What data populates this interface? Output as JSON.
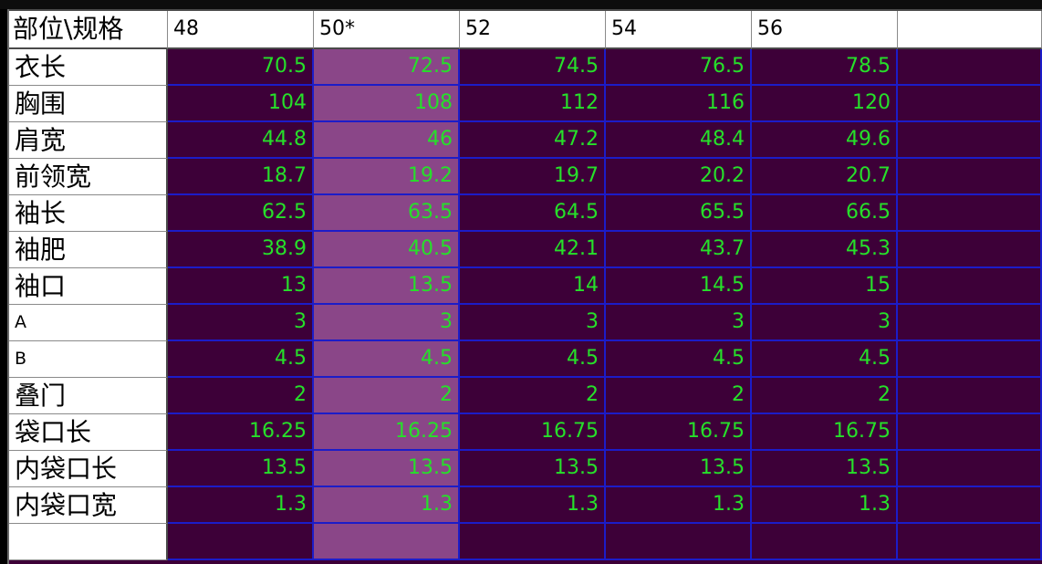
{
  "table": {
    "corner_label": "部位\\规格",
    "size_columns": [
      "48",
      "50*",
      "52",
      "54",
      "56"
    ],
    "selected_column": 1,
    "rows": [
      {
        "label": "衣长",
        "values": [
          "70.5",
          "72.5",
          "74.5",
          "76.5",
          "78.5"
        ]
      },
      {
        "label": "胸围",
        "values": [
          "104",
          "108",
          "112",
          "116",
          "120"
        ]
      },
      {
        "label": "肩宽",
        "values": [
          "44.8",
          "46",
          "47.2",
          "48.4",
          "49.6"
        ]
      },
      {
        "label": "前领宽",
        "values": [
          "18.7",
          "19.2",
          "19.7",
          "20.2",
          "20.7"
        ]
      },
      {
        "label": "袖长",
        "values": [
          "62.5",
          "63.5",
          "64.5",
          "65.5",
          "66.5"
        ]
      },
      {
        "label": "袖肥",
        "values": [
          "38.9",
          "40.5",
          "42.1",
          "43.7",
          "45.3"
        ]
      },
      {
        "label": "袖口",
        "values": [
          "13",
          "13.5",
          "14",
          "14.5",
          "15"
        ]
      },
      {
        "label": "A",
        "values": [
          "3",
          "3",
          "3",
          "3",
          "3"
        ]
      },
      {
        "label": "B",
        "values": [
          "4.5",
          "4.5",
          "4.5",
          "4.5",
          "4.5"
        ]
      },
      {
        "label": "叠门",
        "values": [
          "2",
          "2",
          "2",
          "2",
          "2"
        ]
      },
      {
        "label": "袋口长",
        "values": [
          "16.25",
          "16.25",
          "16.75",
          "16.75",
          "16.75"
        ]
      },
      {
        "label": "内袋口长",
        "values": [
          "13.5",
          "13.5",
          "13.5",
          "13.5",
          "13.5"
        ]
      },
      {
        "label": "内袋口宽",
        "values": [
          "1.3",
          "1.3",
          "1.3",
          "1.3",
          "1.3"
        ]
      },
      {
        "label": "",
        "values": [
          "",
          "",
          "",
          "",
          ""
        ]
      }
    ]
  },
  "colors": {
    "cell_background": "#3d0038",
    "selected_column_background": "#8a4688",
    "value_text": "#26e02a",
    "grid_lines": "#1c1cc8",
    "header_background": "#ffffff"
  }
}
